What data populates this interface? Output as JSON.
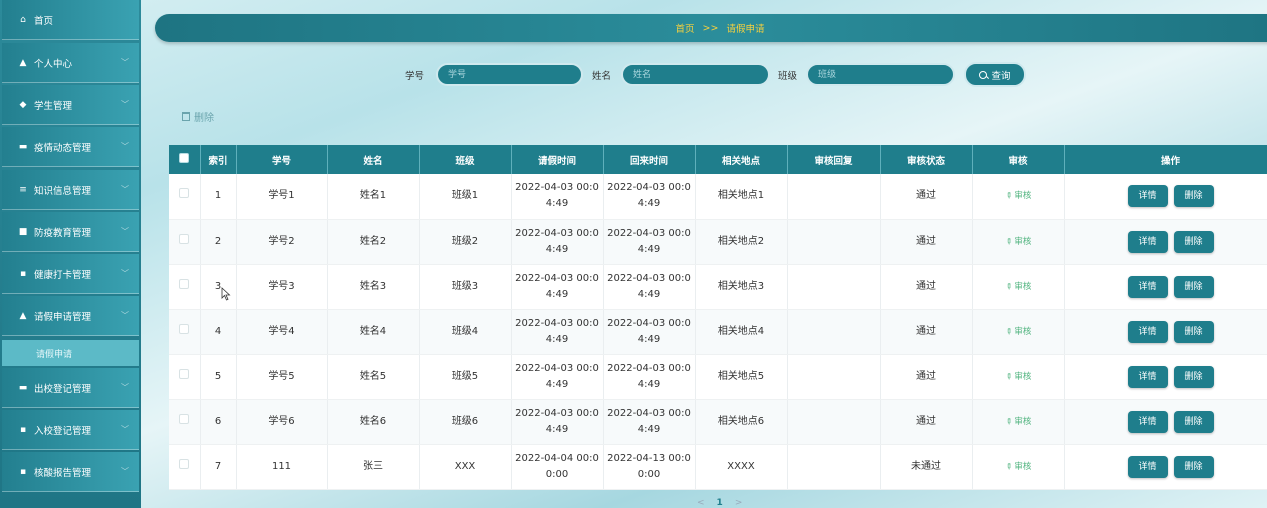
{
  "sidebar": {
    "items": [
      {
        "label": "首页",
        "icon": "home-icon",
        "glyph": "⌂"
      },
      {
        "label": "个人中心",
        "icon": "user-icon",
        "glyph": "▲"
      },
      {
        "label": "学生管理",
        "icon": "thumb-icon",
        "glyph": "◆"
      },
      {
        "label": "疫情动态管理",
        "icon": "card-icon",
        "glyph": "▬"
      },
      {
        "label": "知识信息管理",
        "icon": "menu-icon",
        "glyph": "≡"
      },
      {
        "label": "防疫教育管理",
        "icon": "doc-icon",
        "glyph": "■"
      },
      {
        "label": "健康打卡管理",
        "icon": "grid-icon",
        "glyph": "▪"
      },
      {
        "label": "请假申请管理",
        "icon": "user-icon",
        "glyph": "▲"
      },
      {
        "label": "出校登记管理",
        "icon": "chat-icon",
        "glyph": "▬"
      },
      {
        "label": "入校登记管理",
        "icon": "grid-icon",
        "glyph": "▪"
      },
      {
        "label": "核酸报告管理",
        "icon": "grid-icon",
        "glyph": "▪"
      }
    ],
    "sub_item": "请假申请"
  },
  "breadcrumb": {
    "home": "首页",
    "sep": ">>",
    "current": "请假申请"
  },
  "search": {
    "label_xuehao": "学号",
    "ph_xuehao": "学号",
    "label_name": "姓名",
    "ph_name": "姓名",
    "label_class": "班级",
    "ph_class": "班级",
    "button": "查询"
  },
  "toolbar": {
    "delete": "删除"
  },
  "table": {
    "headers": [
      "索引",
      "学号",
      "姓名",
      "班级",
      "请假时间",
      "回来时间",
      "相关地点",
      "审核回复",
      "审核状态",
      "审核",
      "操作"
    ],
    "rows": [
      {
        "idx": "1",
        "xuehao": "学号1",
        "name": "姓名1",
        "class": "班级1",
        "leave1": "2022-04-03 00:0",
        "leave2": "4:49",
        "back1": "2022-04-03 00:0",
        "back2": "4:49",
        "place": "相关地点1",
        "reply": "",
        "status": "通过"
      },
      {
        "idx": "2",
        "xuehao": "学号2",
        "name": "姓名2",
        "class": "班级2",
        "leave1": "2022-04-03 00:0",
        "leave2": "4:49",
        "back1": "2022-04-03 00:0",
        "back2": "4:49",
        "place": "相关地点2",
        "reply": "",
        "status": "通过"
      },
      {
        "idx": "3",
        "xuehao": "学号3",
        "name": "姓名3",
        "class": "班级3",
        "leave1": "2022-04-03 00:0",
        "leave2": "4:49",
        "back1": "2022-04-03 00:0",
        "back2": "4:49",
        "place": "相关地点3",
        "reply": "",
        "status": "通过"
      },
      {
        "idx": "4",
        "xuehao": "学号4",
        "name": "姓名4",
        "class": "班级4",
        "leave1": "2022-04-03 00:0",
        "leave2": "4:49",
        "back1": "2022-04-03 00:0",
        "back2": "4:49",
        "place": "相关地点4",
        "reply": "",
        "status": "通过"
      },
      {
        "idx": "5",
        "xuehao": "学号5",
        "name": "姓名5",
        "class": "班级5",
        "leave1": "2022-04-03 00:0",
        "leave2": "4:49",
        "back1": "2022-04-03 00:0",
        "back2": "4:49",
        "place": "相关地点5",
        "reply": "",
        "status": "通过"
      },
      {
        "idx": "6",
        "xuehao": "学号6",
        "name": "姓名6",
        "class": "班级6",
        "leave1": "2022-04-03 00:0",
        "leave2": "4:49",
        "back1": "2022-04-03 00:0",
        "back2": "4:49",
        "place": "相关地点6",
        "reply": "",
        "status": "通过"
      },
      {
        "idx": "7",
        "xuehao": "111",
        "name": "张三",
        "class": "XXX",
        "leave1": "2022-04-04 00:0",
        "leave2": "0:00",
        "back1": "2022-04-13 00:0",
        "back2": "0:00",
        "place": "XXXX",
        "reply": "",
        "status": "未通过"
      }
    ],
    "audit_label": "审核",
    "detail_label": "详情",
    "delete_label": "删除"
  },
  "pager": {
    "prev": "<",
    "page": "1",
    "next": ">"
  },
  "colors": {
    "primary": "#1f7e8c",
    "crumb_text": "#f4d03f",
    "audit": "#4fb37e"
  }
}
